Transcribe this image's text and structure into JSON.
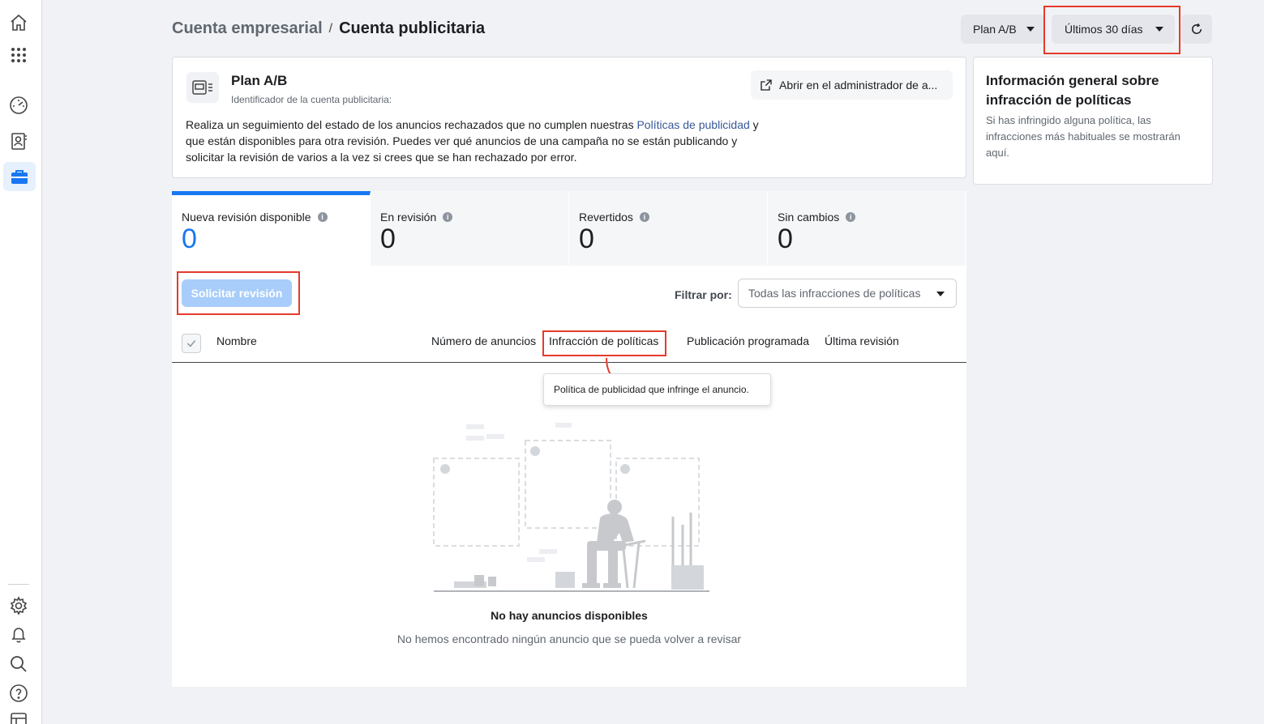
{
  "breadcrumb": {
    "business": "Cuenta empresarial",
    "separator": "/",
    "ad_account": "Cuenta publicitaria"
  },
  "toolbar": {
    "account_select": "Plan A/B",
    "date_range": "Últimos 30 días"
  },
  "account_card": {
    "title": "Plan A/B",
    "subtitle": "Identificador de la cuenta publicitaria:",
    "open_button": "Abrir en el administrador de a...",
    "description_before_link": "Realiza un seguimiento del estado de los anuncios rechazados que no cumplen nuestras ",
    "description_link": "Políticas de publicidad",
    "description_after_link": " y que están disponibles para otra revisión. Puedes ver qué anuncios de una campaña no se están publicando y solicitar la revisión de varios a la vez si crees que se han rechazado por error."
  },
  "info_card": {
    "title": "Información general sobre infracción de políticas",
    "text": "Si has infringido alguna política, las infracciones más habituales se mostrarán aquí."
  },
  "tabs": [
    {
      "label": "Nueva revisión disponible",
      "value": "0"
    },
    {
      "label": "En revisión",
      "value": "0"
    },
    {
      "label": "Revertidos",
      "value": "0"
    },
    {
      "label": "Sin cambios",
      "value": "0"
    }
  ],
  "actions": {
    "request_review": "Solicitar revisión",
    "filter_label": "Filtrar por:",
    "filter_value": "Todas las infracciones de políticas"
  },
  "table": {
    "columns": [
      "Nombre",
      "Número de anuncios",
      "Infracción de políticas",
      "Publicación programada",
      "Última revisión"
    ]
  },
  "tooltip": "Política de publicidad que infringe el anuncio.",
  "empty_state": {
    "title": "No hay anuncios disponibles",
    "text": "No hemos encontrado ningún anuncio que se pueda volver a revisar"
  },
  "colors": {
    "accent": "#1877f2",
    "highlight": "#e53a2c",
    "disabled_button": "#a8cdfa"
  },
  "icons": [
    "home-icon",
    "apps-grid-icon",
    "dashboard-icon",
    "contacts-icon",
    "briefcase-icon",
    "settings-icon",
    "bell-icon",
    "search-icon",
    "help-icon",
    "reports-icon",
    "refresh-icon",
    "external-link-icon",
    "ad-preview-icon",
    "info-icon",
    "checkmark-icon"
  ]
}
